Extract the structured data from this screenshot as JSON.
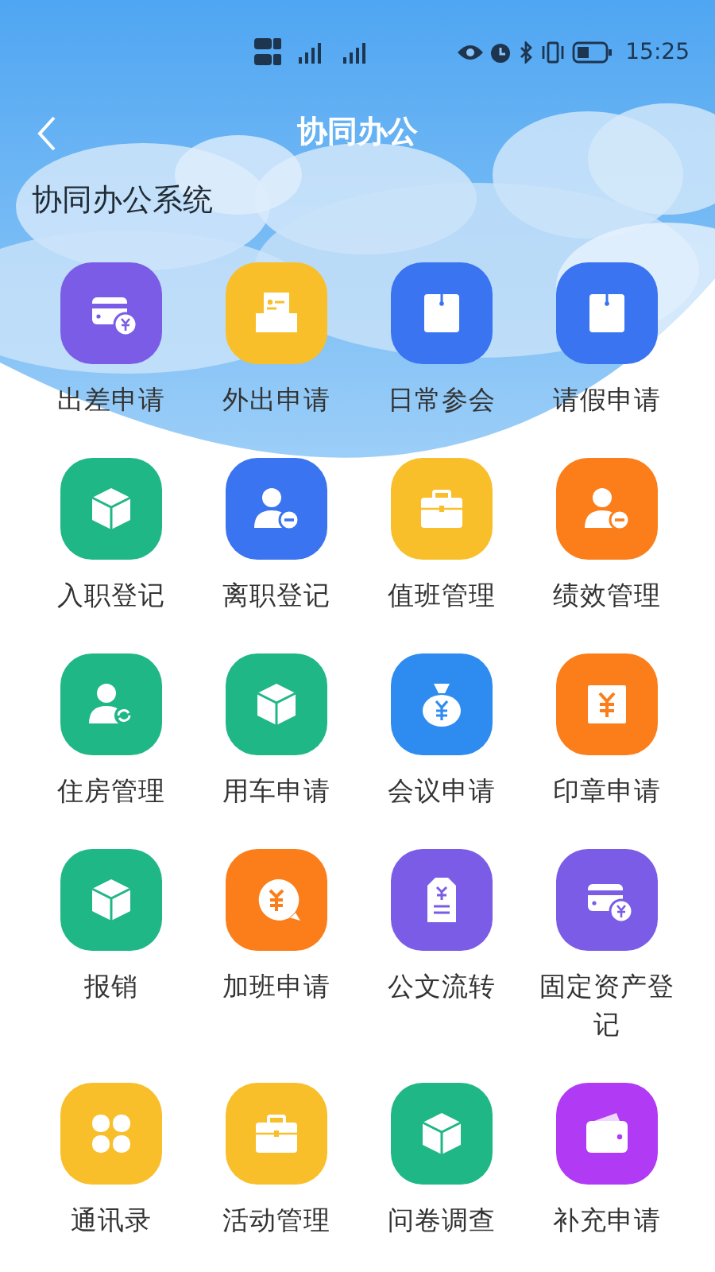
{
  "status_bar": {
    "time": "15:25"
  },
  "header": {
    "title": "协同办公"
  },
  "section_title": "协同办公系统",
  "apps": [
    {
      "label": "出差申请",
      "color": "#7b5ce6"
    },
    {
      "label": "外出申请",
      "color": "#f8bf2a"
    },
    {
      "label": "日常参会",
      "color": "#3b74f0"
    },
    {
      "label": "请假申请",
      "color": "#3b74f0"
    },
    {
      "label": "入职登记",
      "color": "#20b786"
    },
    {
      "label": "离职登记",
      "color": "#3b74f0"
    },
    {
      "label": "值班管理",
      "color": "#f8bf2a"
    },
    {
      "label": "绩效管理",
      "color": "#fb7e1a"
    },
    {
      "label": "住房管理",
      "color": "#20b786"
    },
    {
      "label": "用车申请",
      "color": "#20b786"
    },
    {
      "label": "会议申请",
      "color": "#2e8cf0"
    },
    {
      "label": "印章申请",
      "color": "#fb7e1a"
    },
    {
      "label": "报销",
      "color": "#20b786"
    },
    {
      "label": "加班申请",
      "color": "#fb7e1a"
    },
    {
      "label": "公文流转",
      "color": "#7b5ce6"
    },
    {
      "label": "固定资产登记",
      "color": "#7b5ce6"
    },
    {
      "label": "通讯录",
      "color": "#f8bf2a"
    },
    {
      "label": "活动管理",
      "color": "#f8bf2a"
    },
    {
      "label": "问卷调查",
      "color": "#20b786"
    },
    {
      "label": "补充申请",
      "color": "#b13af5"
    }
  ]
}
